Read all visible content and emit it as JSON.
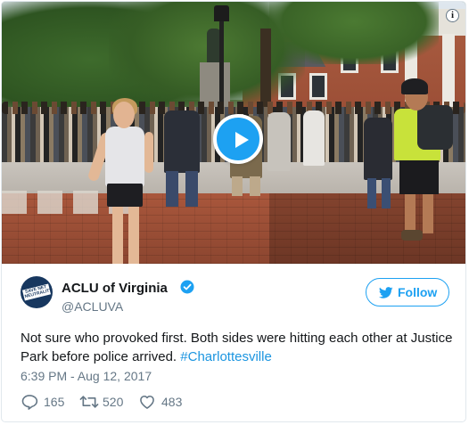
{
  "tweet": {
    "display_name": "ACLU of Virginia",
    "handle": "@ACLUVA",
    "avatar_text": "SAVE NET NEUTRALITY",
    "follow_label": "Follow",
    "text_main": "Not sure who provoked first. Both sides were hitting each other at Justice Park before police arrived. ",
    "hashtag": "#Charlottesville",
    "timestamp": "6:39 PM - Aug 12, 2017",
    "stats": {
      "replies": "165",
      "retweets": "520",
      "likes": "483"
    }
  },
  "media": {
    "info_badge": "i",
    "play_button_color": "#1da1f2"
  },
  "colors": {
    "accent": "#1da1f2",
    "text": "#14171a",
    "muted": "#657786",
    "link": "#1b95e0"
  },
  "icons": [
    "play-icon",
    "info-icon",
    "verified-icon",
    "twitter-bird-icon",
    "reply-icon",
    "retweet-icon",
    "like-icon"
  ]
}
